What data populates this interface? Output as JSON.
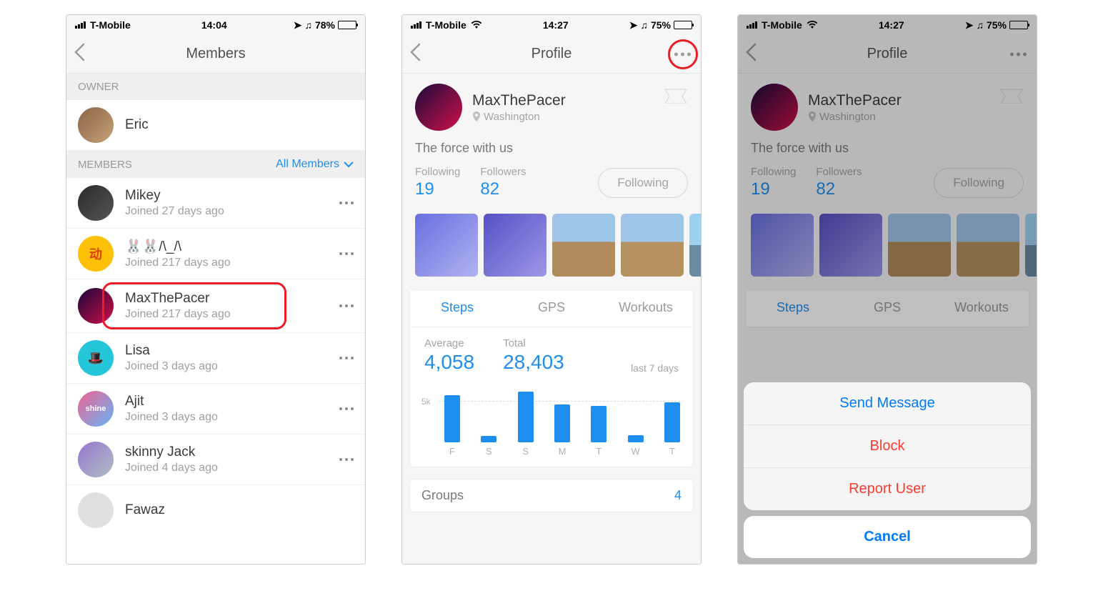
{
  "screen1": {
    "status": {
      "carrier": "T-Mobile",
      "time": "14:04",
      "battery_pct": "78%",
      "battery_fill": 78
    },
    "title": "Members",
    "owner_header": "OWNER",
    "owner": {
      "name": "Eric"
    },
    "members_header": "MEMBERS",
    "members_filter": "All Members",
    "members": [
      {
        "name": "Mikey",
        "sub": "Joined 27 days ago"
      },
      {
        "name": "🐰🐰/\\_/\\",
        "sub": "Joined 217 days ago"
      },
      {
        "name": "MaxThePacer",
        "sub": "Joined 217 days ago",
        "highlighted": true
      },
      {
        "name": "Lisa",
        "sub": "Joined 3 days ago"
      },
      {
        "name": "Ajit",
        "sub": "Joined 3 days ago"
      },
      {
        "name": "skinny Jack",
        "sub": "Joined 4 days ago"
      },
      {
        "name": "Fawaz",
        "sub": ""
      }
    ]
  },
  "screen2": {
    "status": {
      "carrier": "T-Mobile",
      "time": "14:27",
      "battery_pct": "75%",
      "battery_fill": 75
    },
    "title": "Profile",
    "profile": {
      "name": "MaxThePacer",
      "location": "Washington",
      "bio": "The force with us",
      "following_label": "Following",
      "following": "19",
      "followers_label": "Followers",
      "followers": "82",
      "follow_button": "Following"
    },
    "tabs": {
      "steps": "Steps",
      "gps": "GPS",
      "workouts": "Workouts"
    },
    "metrics": {
      "average_label": "Average",
      "average": "4,058",
      "total_label": "Total",
      "total": "28,403",
      "range": "last 7 days"
    },
    "chart_data": {
      "type": "bar",
      "categories": [
        "F",
        "S",
        "S",
        "M",
        "T",
        "W",
        "T"
      ],
      "values": [
        5200,
        700,
        5600,
        4200,
        4000,
        800,
        4400
      ],
      "ylabel_tick": "5k",
      "ylim": [
        0,
        6000
      ]
    },
    "groups": {
      "label": "Groups",
      "count": "4"
    }
  },
  "screen3": {
    "action_sheet": {
      "send": "Send Message",
      "block": "Block",
      "report": "Report User",
      "cancel": "Cancel"
    }
  }
}
